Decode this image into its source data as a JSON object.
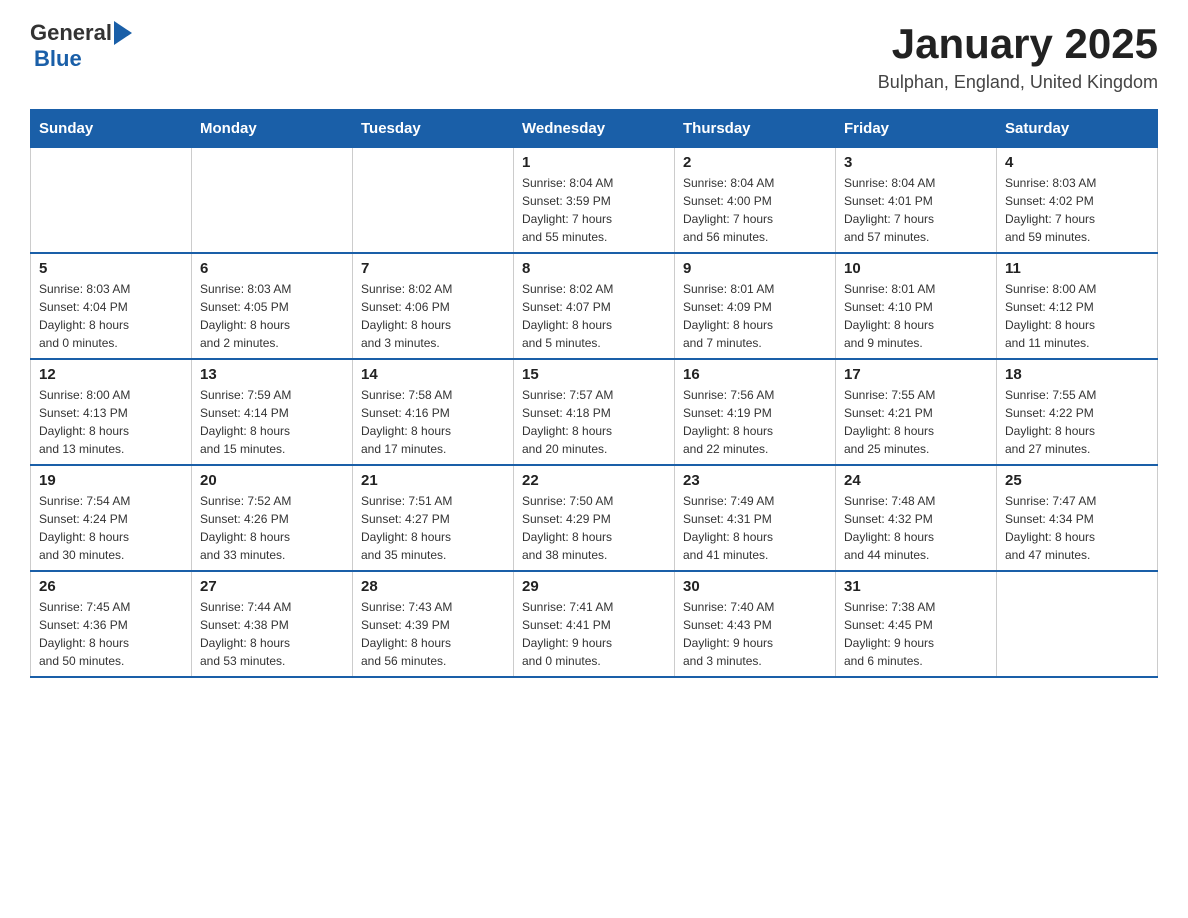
{
  "header": {
    "logo_general": "General",
    "logo_blue": "Blue",
    "title": "January 2025",
    "subtitle": "Bulphan, England, United Kingdom"
  },
  "days_of_week": [
    "Sunday",
    "Monday",
    "Tuesday",
    "Wednesday",
    "Thursday",
    "Friday",
    "Saturday"
  ],
  "weeks": [
    {
      "cells": [
        {
          "day": "",
          "info": ""
        },
        {
          "day": "",
          "info": ""
        },
        {
          "day": "",
          "info": ""
        },
        {
          "day": "1",
          "info": "Sunrise: 8:04 AM\nSunset: 3:59 PM\nDaylight: 7 hours\nand 55 minutes."
        },
        {
          "day": "2",
          "info": "Sunrise: 8:04 AM\nSunset: 4:00 PM\nDaylight: 7 hours\nand 56 minutes."
        },
        {
          "day": "3",
          "info": "Sunrise: 8:04 AM\nSunset: 4:01 PM\nDaylight: 7 hours\nand 57 minutes."
        },
        {
          "day": "4",
          "info": "Sunrise: 8:03 AM\nSunset: 4:02 PM\nDaylight: 7 hours\nand 59 minutes."
        }
      ]
    },
    {
      "cells": [
        {
          "day": "5",
          "info": "Sunrise: 8:03 AM\nSunset: 4:04 PM\nDaylight: 8 hours\nand 0 minutes."
        },
        {
          "day": "6",
          "info": "Sunrise: 8:03 AM\nSunset: 4:05 PM\nDaylight: 8 hours\nand 2 minutes."
        },
        {
          "day": "7",
          "info": "Sunrise: 8:02 AM\nSunset: 4:06 PM\nDaylight: 8 hours\nand 3 minutes."
        },
        {
          "day": "8",
          "info": "Sunrise: 8:02 AM\nSunset: 4:07 PM\nDaylight: 8 hours\nand 5 minutes."
        },
        {
          "day": "9",
          "info": "Sunrise: 8:01 AM\nSunset: 4:09 PM\nDaylight: 8 hours\nand 7 minutes."
        },
        {
          "day": "10",
          "info": "Sunrise: 8:01 AM\nSunset: 4:10 PM\nDaylight: 8 hours\nand 9 minutes."
        },
        {
          "day": "11",
          "info": "Sunrise: 8:00 AM\nSunset: 4:12 PM\nDaylight: 8 hours\nand 11 minutes."
        }
      ]
    },
    {
      "cells": [
        {
          "day": "12",
          "info": "Sunrise: 8:00 AM\nSunset: 4:13 PM\nDaylight: 8 hours\nand 13 minutes."
        },
        {
          "day": "13",
          "info": "Sunrise: 7:59 AM\nSunset: 4:14 PM\nDaylight: 8 hours\nand 15 minutes."
        },
        {
          "day": "14",
          "info": "Sunrise: 7:58 AM\nSunset: 4:16 PM\nDaylight: 8 hours\nand 17 minutes."
        },
        {
          "day": "15",
          "info": "Sunrise: 7:57 AM\nSunset: 4:18 PM\nDaylight: 8 hours\nand 20 minutes."
        },
        {
          "day": "16",
          "info": "Sunrise: 7:56 AM\nSunset: 4:19 PM\nDaylight: 8 hours\nand 22 minutes."
        },
        {
          "day": "17",
          "info": "Sunrise: 7:55 AM\nSunset: 4:21 PM\nDaylight: 8 hours\nand 25 minutes."
        },
        {
          "day": "18",
          "info": "Sunrise: 7:55 AM\nSunset: 4:22 PM\nDaylight: 8 hours\nand 27 minutes."
        }
      ]
    },
    {
      "cells": [
        {
          "day": "19",
          "info": "Sunrise: 7:54 AM\nSunset: 4:24 PM\nDaylight: 8 hours\nand 30 minutes."
        },
        {
          "day": "20",
          "info": "Sunrise: 7:52 AM\nSunset: 4:26 PM\nDaylight: 8 hours\nand 33 minutes."
        },
        {
          "day": "21",
          "info": "Sunrise: 7:51 AM\nSunset: 4:27 PM\nDaylight: 8 hours\nand 35 minutes."
        },
        {
          "day": "22",
          "info": "Sunrise: 7:50 AM\nSunset: 4:29 PM\nDaylight: 8 hours\nand 38 minutes."
        },
        {
          "day": "23",
          "info": "Sunrise: 7:49 AM\nSunset: 4:31 PM\nDaylight: 8 hours\nand 41 minutes."
        },
        {
          "day": "24",
          "info": "Sunrise: 7:48 AM\nSunset: 4:32 PM\nDaylight: 8 hours\nand 44 minutes."
        },
        {
          "day": "25",
          "info": "Sunrise: 7:47 AM\nSunset: 4:34 PM\nDaylight: 8 hours\nand 47 minutes."
        }
      ]
    },
    {
      "cells": [
        {
          "day": "26",
          "info": "Sunrise: 7:45 AM\nSunset: 4:36 PM\nDaylight: 8 hours\nand 50 minutes."
        },
        {
          "day": "27",
          "info": "Sunrise: 7:44 AM\nSunset: 4:38 PM\nDaylight: 8 hours\nand 53 minutes."
        },
        {
          "day": "28",
          "info": "Sunrise: 7:43 AM\nSunset: 4:39 PM\nDaylight: 8 hours\nand 56 minutes."
        },
        {
          "day": "29",
          "info": "Sunrise: 7:41 AM\nSunset: 4:41 PM\nDaylight: 9 hours\nand 0 minutes."
        },
        {
          "day": "30",
          "info": "Sunrise: 7:40 AM\nSunset: 4:43 PM\nDaylight: 9 hours\nand 3 minutes."
        },
        {
          "day": "31",
          "info": "Sunrise: 7:38 AM\nSunset: 4:45 PM\nDaylight: 9 hours\nand 6 minutes."
        },
        {
          "day": "",
          "info": ""
        }
      ]
    }
  ]
}
